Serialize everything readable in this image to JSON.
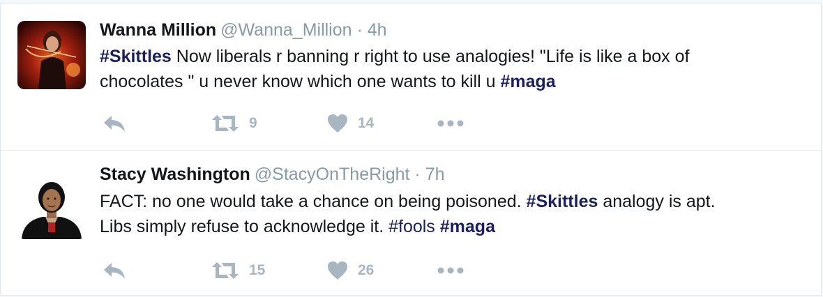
{
  "tweets": [
    {
      "name": "Wanna Million",
      "handle": "@Wanna_Million",
      "separator": "·",
      "time": "4h",
      "text": {
        "l1_tag": "#Skittles",
        "l1_rest": " Now liberals r banning r right to use analogies! \"Life is like a box of",
        "l2_rest": "chocolates \" u never know which one wants to kill u ",
        "l2_tag": "#maga"
      },
      "retweets": "9",
      "likes": "14"
    },
    {
      "name": "Stacy Washington",
      "handle": "@StacyOnTheRight",
      "separator": "·",
      "time": "7h",
      "text": {
        "l1_start": "FACT: no one would take a chance on being poisoned. ",
        "l1_tag": "#Skittles",
        "l1_end": " analogy is apt.",
        "l2_start": "Libs simply refuse to acknowledge it. ",
        "l2_tag1": "#fools",
        "l2_space": " ",
        "l2_tag2": "#maga"
      },
      "retweets": "15",
      "likes": "26"
    }
  ],
  "icons": {
    "reply": "reply-icon",
    "retweet": "retweet-icon",
    "like": "heart-icon",
    "more": "more-icon"
  },
  "colors": {
    "hashtag": "#1b1f5c",
    "action_gray": "#a8b6c2",
    "handle_gray": "#8899a6",
    "divider": "#e1e8ed"
  }
}
